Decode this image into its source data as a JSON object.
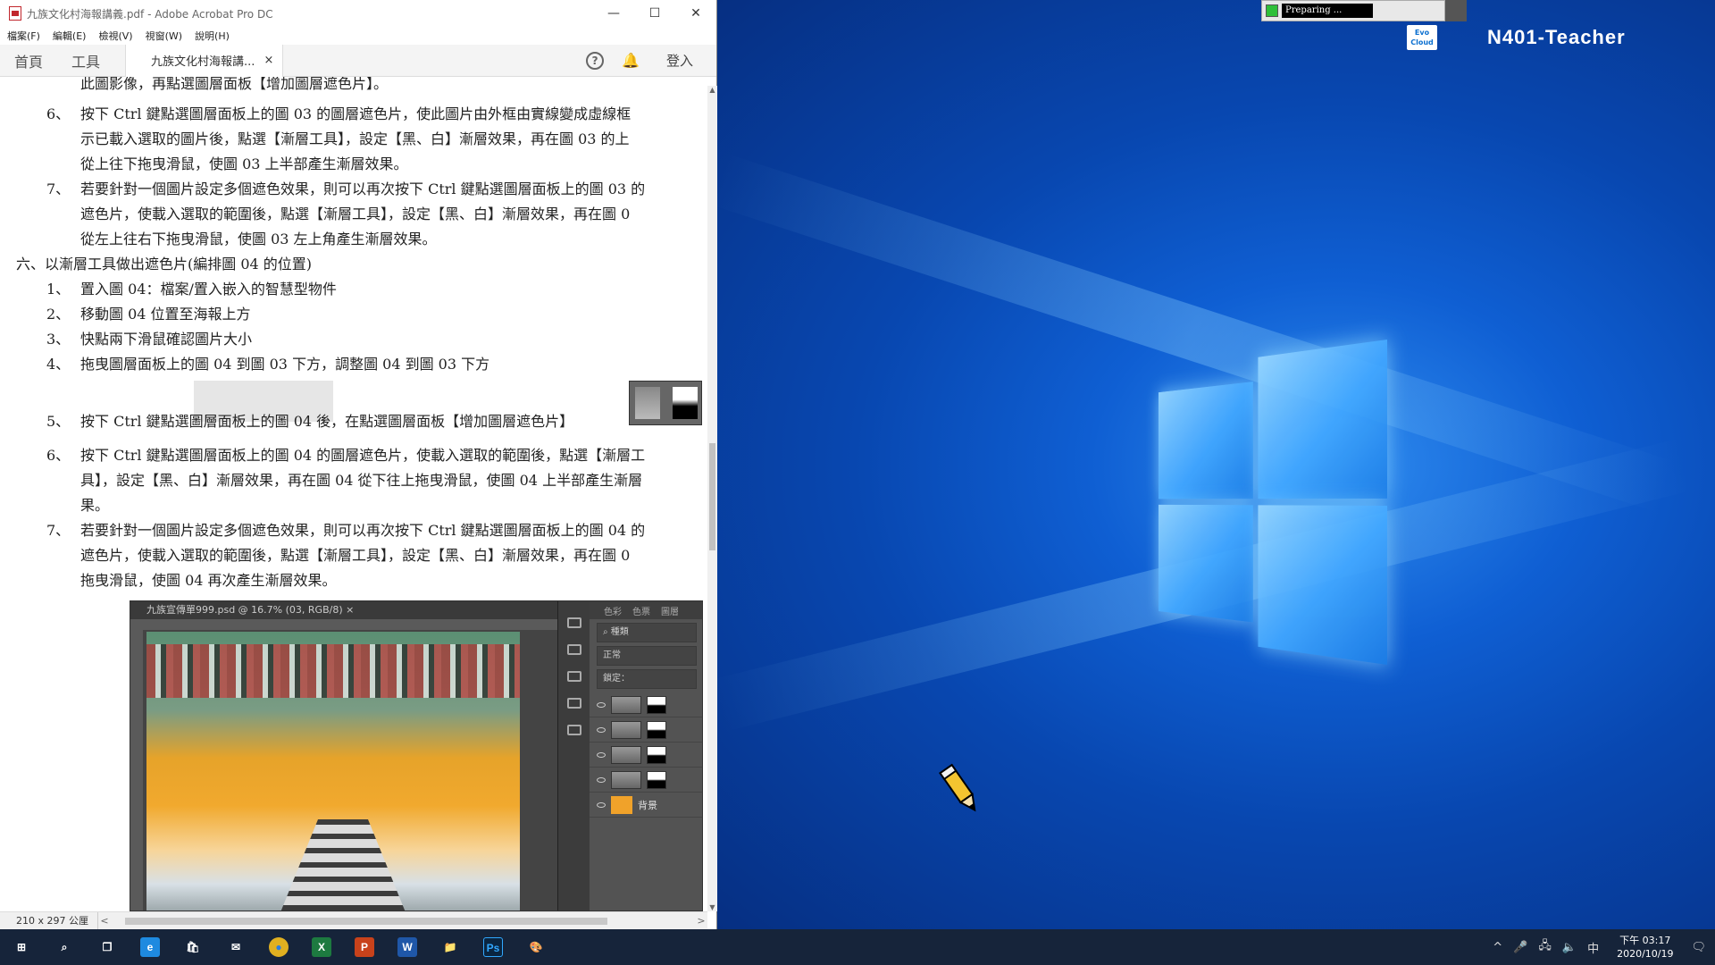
{
  "acrobat": {
    "title": "九族文化村海報講義.pdf - Adobe Acrobat Pro DC",
    "window_controls": {
      "minimize": "—",
      "maximize": "☐",
      "close": "✕"
    },
    "menu": [
      "檔案(F)",
      "編輯(E)",
      "檢視(V)",
      "視窗(W)",
      "說明(H)"
    ],
    "tabs": {
      "home": "首頁",
      "tools": "工具",
      "doc_tab": "九族文化村海報講...",
      "doc_close": "×"
    },
    "help": "?",
    "bell": "🔔",
    "login": "登入",
    "page_size": "210 x 297 公厘",
    "scroll_left": "<",
    "scroll_right": ">",
    "scroll_up": "▲",
    "scroll_down": "▼"
  },
  "document": {
    "top_partial": "此圖影像，再點選圖層面板【增加圖層遮色片】。",
    "items_a": [
      {
        "num": "6、",
        "lines": [
          "按下 Ctrl 鍵點選圖層面板上的圖 03 的圖層遮色片，使此圖片由外框由實線變成虛線框",
          "示已載入選取的圖片後，點選【漸層工具】，設定【黑、白】漸層效果，再在圖 03 的上",
          "從上往下拖曳滑鼠，使圖 03 上半部產生漸層效果。"
        ]
      },
      {
        "num": "7、",
        "lines": [
          "若要針對一個圖片設定多個遮色效果，則可以再次按下 Ctrl 鍵點選圖層面板上的圖 03 的",
          "遮色片，使載入選取的範圍後，點選【漸層工具】，設定【黑、白】漸層效果，再在圖 0",
          "從左上往右下拖曳滑鼠，使圖 03 左上角產生漸層效果。"
        ]
      }
    ],
    "section_heading": "六、以漸層工具做出遮色片(編排圖 04 的位置)",
    "items_b": [
      {
        "num": "1、",
        "text": "置入圖 04：檔案/置入嵌入的智慧型物件"
      },
      {
        "num": "2、",
        "text": "移動圖 04 位置至海報上方"
      },
      {
        "num": "3、",
        "text": "快點兩下滑鼠確認圖片大小"
      },
      {
        "num": "4、",
        "text": "拖曳圖層面板上的圖 04 到圖 03 下方，調整圖 04 到圖 03 下方"
      }
    ],
    "item_b5": {
      "num": "5、",
      "text": "按下 Ctrl 鍵點選圖層面板上的圖 04 後，在點選圖層面板【增加圖層遮色片】"
    },
    "items_c": [
      {
        "num": "6、",
        "lines": [
          "按下 Ctrl 鍵點選圖層面板上的圖 04 的圖層遮色片，使載入選取的範圍後，點選【漸層工",
          "具】，設定【黑、白】漸層效果，再在圖 04 從下往上拖曳滑鼠，使圖 04 上半部產生漸層",
          "果。"
        ]
      },
      {
        "num": "7、",
        "lines": [
          "若要針對一個圖片設定多個遮色效果，則可以再次按下 Ctrl 鍵點選圖層面板上的圖 04 的",
          "遮色片，使載入選取的範圍後，點選【漸層工具】，設定【黑、白】漸層效果，再在圖 0",
          "拖曳滑鼠，使圖 04 再次產生漸層效果。"
        ]
      }
    ]
  },
  "photoshop": {
    "tab": "九族宣傳單999.psd @ 16.7% (03, RGB/8)  ×",
    "panel_tabs": [
      "色彩",
      "色票",
      "圖層"
    ],
    "filter": "⌕ 種類",
    "blend": "正常",
    "lock": "鎖定：",
    "bg_layer": "背景"
  },
  "desktop": {
    "preparing": "Preparing ...",
    "machine_name": "N401-Teacher",
    "badge": "Evo Cloud"
  },
  "taskbar": {
    "apps": [
      {
        "name": "start",
        "glyph": "⊞",
        "color": "#16243a"
      },
      {
        "name": "search",
        "glyph": "⌕",
        "color": "#16243a"
      },
      {
        "name": "task-view",
        "glyph": "❐",
        "color": "#16243a"
      },
      {
        "name": "edge",
        "glyph": "e",
        "color": "#1e8ae0"
      },
      {
        "name": "store",
        "glyph": "🛍",
        "color": "#16243a"
      },
      {
        "name": "mail",
        "glyph": "✉",
        "color": "#16243a"
      },
      {
        "name": "chrome",
        "glyph": "●",
        "color": "#e0b020"
      },
      {
        "name": "excel",
        "glyph": "X",
        "color": "#1d7a40"
      },
      {
        "name": "powerpoint",
        "glyph": "P",
        "color": "#c8421b"
      },
      {
        "name": "word",
        "glyph": "W",
        "color": "#1f57a8"
      },
      {
        "name": "explorer",
        "glyph": "📁",
        "color": "#e0a820"
      },
      {
        "name": "photoshop",
        "glyph": "Ps",
        "color": "#0a2540"
      },
      {
        "name": "paint",
        "glyph": "🎨",
        "color": "#16243a"
      }
    ],
    "tray_chevron": "^",
    "mic": "🎤",
    "network": "🖧",
    "volume": "🔈",
    "ime": "中",
    "time": "下午 03:17",
    "date": "2020/10/19",
    "notifications": "🗨"
  },
  "colors": {
    "taskbar": "#16243a",
    "desktop_blue": "#0f5fd3",
    "ps_orange": "#f0a22a"
  }
}
